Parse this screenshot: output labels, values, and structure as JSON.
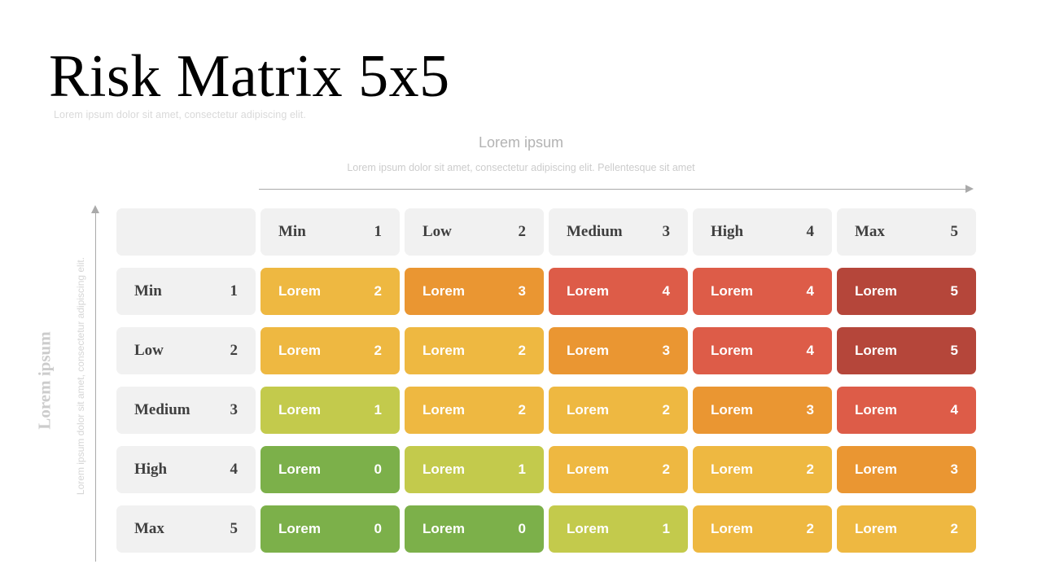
{
  "slide": {
    "title": "Risk Matrix 5x5",
    "subtitle": "Lorem ipsum dolor sit amet, consectetur adipiscing elit."
  },
  "x_axis": {
    "title": "Lorem ipsum",
    "subtitle": "Lorem ipsum dolor sit amet, consectetur adipiscing elit. Pellentesque sit amet"
  },
  "y_axis": {
    "title": "Lorem ipsum",
    "subtitle": "Lorem ipsum dolor sit amet, consectetur adipiscing elit."
  },
  "colors": {
    "header_bg": "#f1f1f1",
    "header_text": "#3f3f3f",
    "green": "#7cb04a",
    "yellow_green": "#c3ca4c",
    "yellow": "#eeb841",
    "orange": "#ea9632",
    "red": "#dd5c48",
    "dark_red": "#b5463a",
    "axis_line": "#aaaaaa",
    "muted_text": "#cccccc"
  },
  "chart_data": {
    "type": "heatmap",
    "title": "Risk Matrix 5x5",
    "xlabel": "Lorem ipsum",
    "ylabel": "Lorem ipsum",
    "grid": false,
    "legend": "none",
    "column_headers": [
      {
        "label": "",
        "value": ""
      },
      {
        "label": "Min",
        "value": "1"
      },
      {
        "label": "Low",
        "value": "2"
      },
      {
        "label": "Medium",
        "value": "3"
      },
      {
        "label": "High",
        "value": "4"
      },
      {
        "label": "Max",
        "value": "5"
      }
    ],
    "row_headers": [
      {
        "label": "Min",
        "value": "1"
      },
      {
        "label": "Low",
        "value": "2"
      },
      {
        "label": "Medium",
        "value": "3"
      },
      {
        "label": "High",
        "value": "4"
      },
      {
        "label": "Max",
        "value": "5"
      }
    ],
    "cell_label": "Lorem",
    "rows": [
      {
        "header": {
          "label": "Min",
          "value": "1"
        },
        "cells": [
          {
            "label": "Lorem",
            "value": "2",
            "color": "#eeb841"
          },
          {
            "label": "Lorem",
            "value": "3",
            "color": "#ea9632"
          },
          {
            "label": "Lorem",
            "value": "4",
            "color": "#dd5c48"
          },
          {
            "label": "Lorem",
            "value": "4",
            "color": "#dd5c48"
          },
          {
            "label": "Lorem",
            "value": "5",
            "color": "#b5463a"
          }
        ]
      },
      {
        "header": {
          "label": "Low",
          "value": "2"
        },
        "cells": [
          {
            "label": "Lorem",
            "value": "2",
            "color": "#eeb841"
          },
          {
            "label": "Lorem",
            "value": "2",
            "color": "#eeb841"
          },
          {
            "label": "Lorem",
            "value": "3",
            "color": "#ea9632"
          },
          {
            "label": "Lorem",
            "value": "4",
            "color": "#dd5c48"
          },
          {
            "label": "Lorem",
            "value": "5",
            "color": "#b5463a"
          }
        ]
      },
      {
        "header": {
          "label": "Medium",
          "value": "3"
        },
        "cells": [
          {
            "label": "Lorem",
            "value": "1",
            "color": "#c3ca4c"
          },
          {
            "label": "Lorem",
            "value": "2",
            "color": "#eeb841"
          },
          {
            "label": "Lorem",
            "value": "2",
            "color": "#eeb841"
          },
          {
            "label": "Lorem",
            "value": "3",
            "color": "#ea9632"
          },
          {
            "label": "Lorem",
            "value": "4",
            "color": "#dd5c48"
          }
        ]
      },
      {
        "header": {
          "label": "High",
          "value": "4"
        },
        "cells": [
          {
            "label": "Lorem",
            "value": "0",
            "color": "#7cb04a"
          },
          {
            "label": "Lorem",
            "value": "1",
            "color": "#c3ca4c"
          },
          {
            "label": "Lorem",
            "value": "2",
            "color": "#eeb841"
          },
          {
            "label": "Lorem",
            "value": "2",
            "color": "#eeb841"
          },
          {
            "label": "Lorem",
            "value": "3",
            "color": "#ea9632"
          }
        ]
      },
      {
        "header": {
          "label": "Max",
          "value": "5"
        },
        "cells": [
          {
            "label": "Lorem",
            "value": "0",
            "color": "#7cb04a"
          },
          {
            "label": "Lorem",
            "value": "0",
            "color": "#7cb04a"
          },
          {
            "label": "Lorem",
            "value": "1",
            "color": "#c3ca4c"
          },
          {
            "label": "Lorem",
            "value": "2",
            "color": "#eeb841"
          },
          {
            "label": "Lorem",
            "value": "2",
            "color": "#eeb841"
          }
        ]
      }
    ]
  }
}
